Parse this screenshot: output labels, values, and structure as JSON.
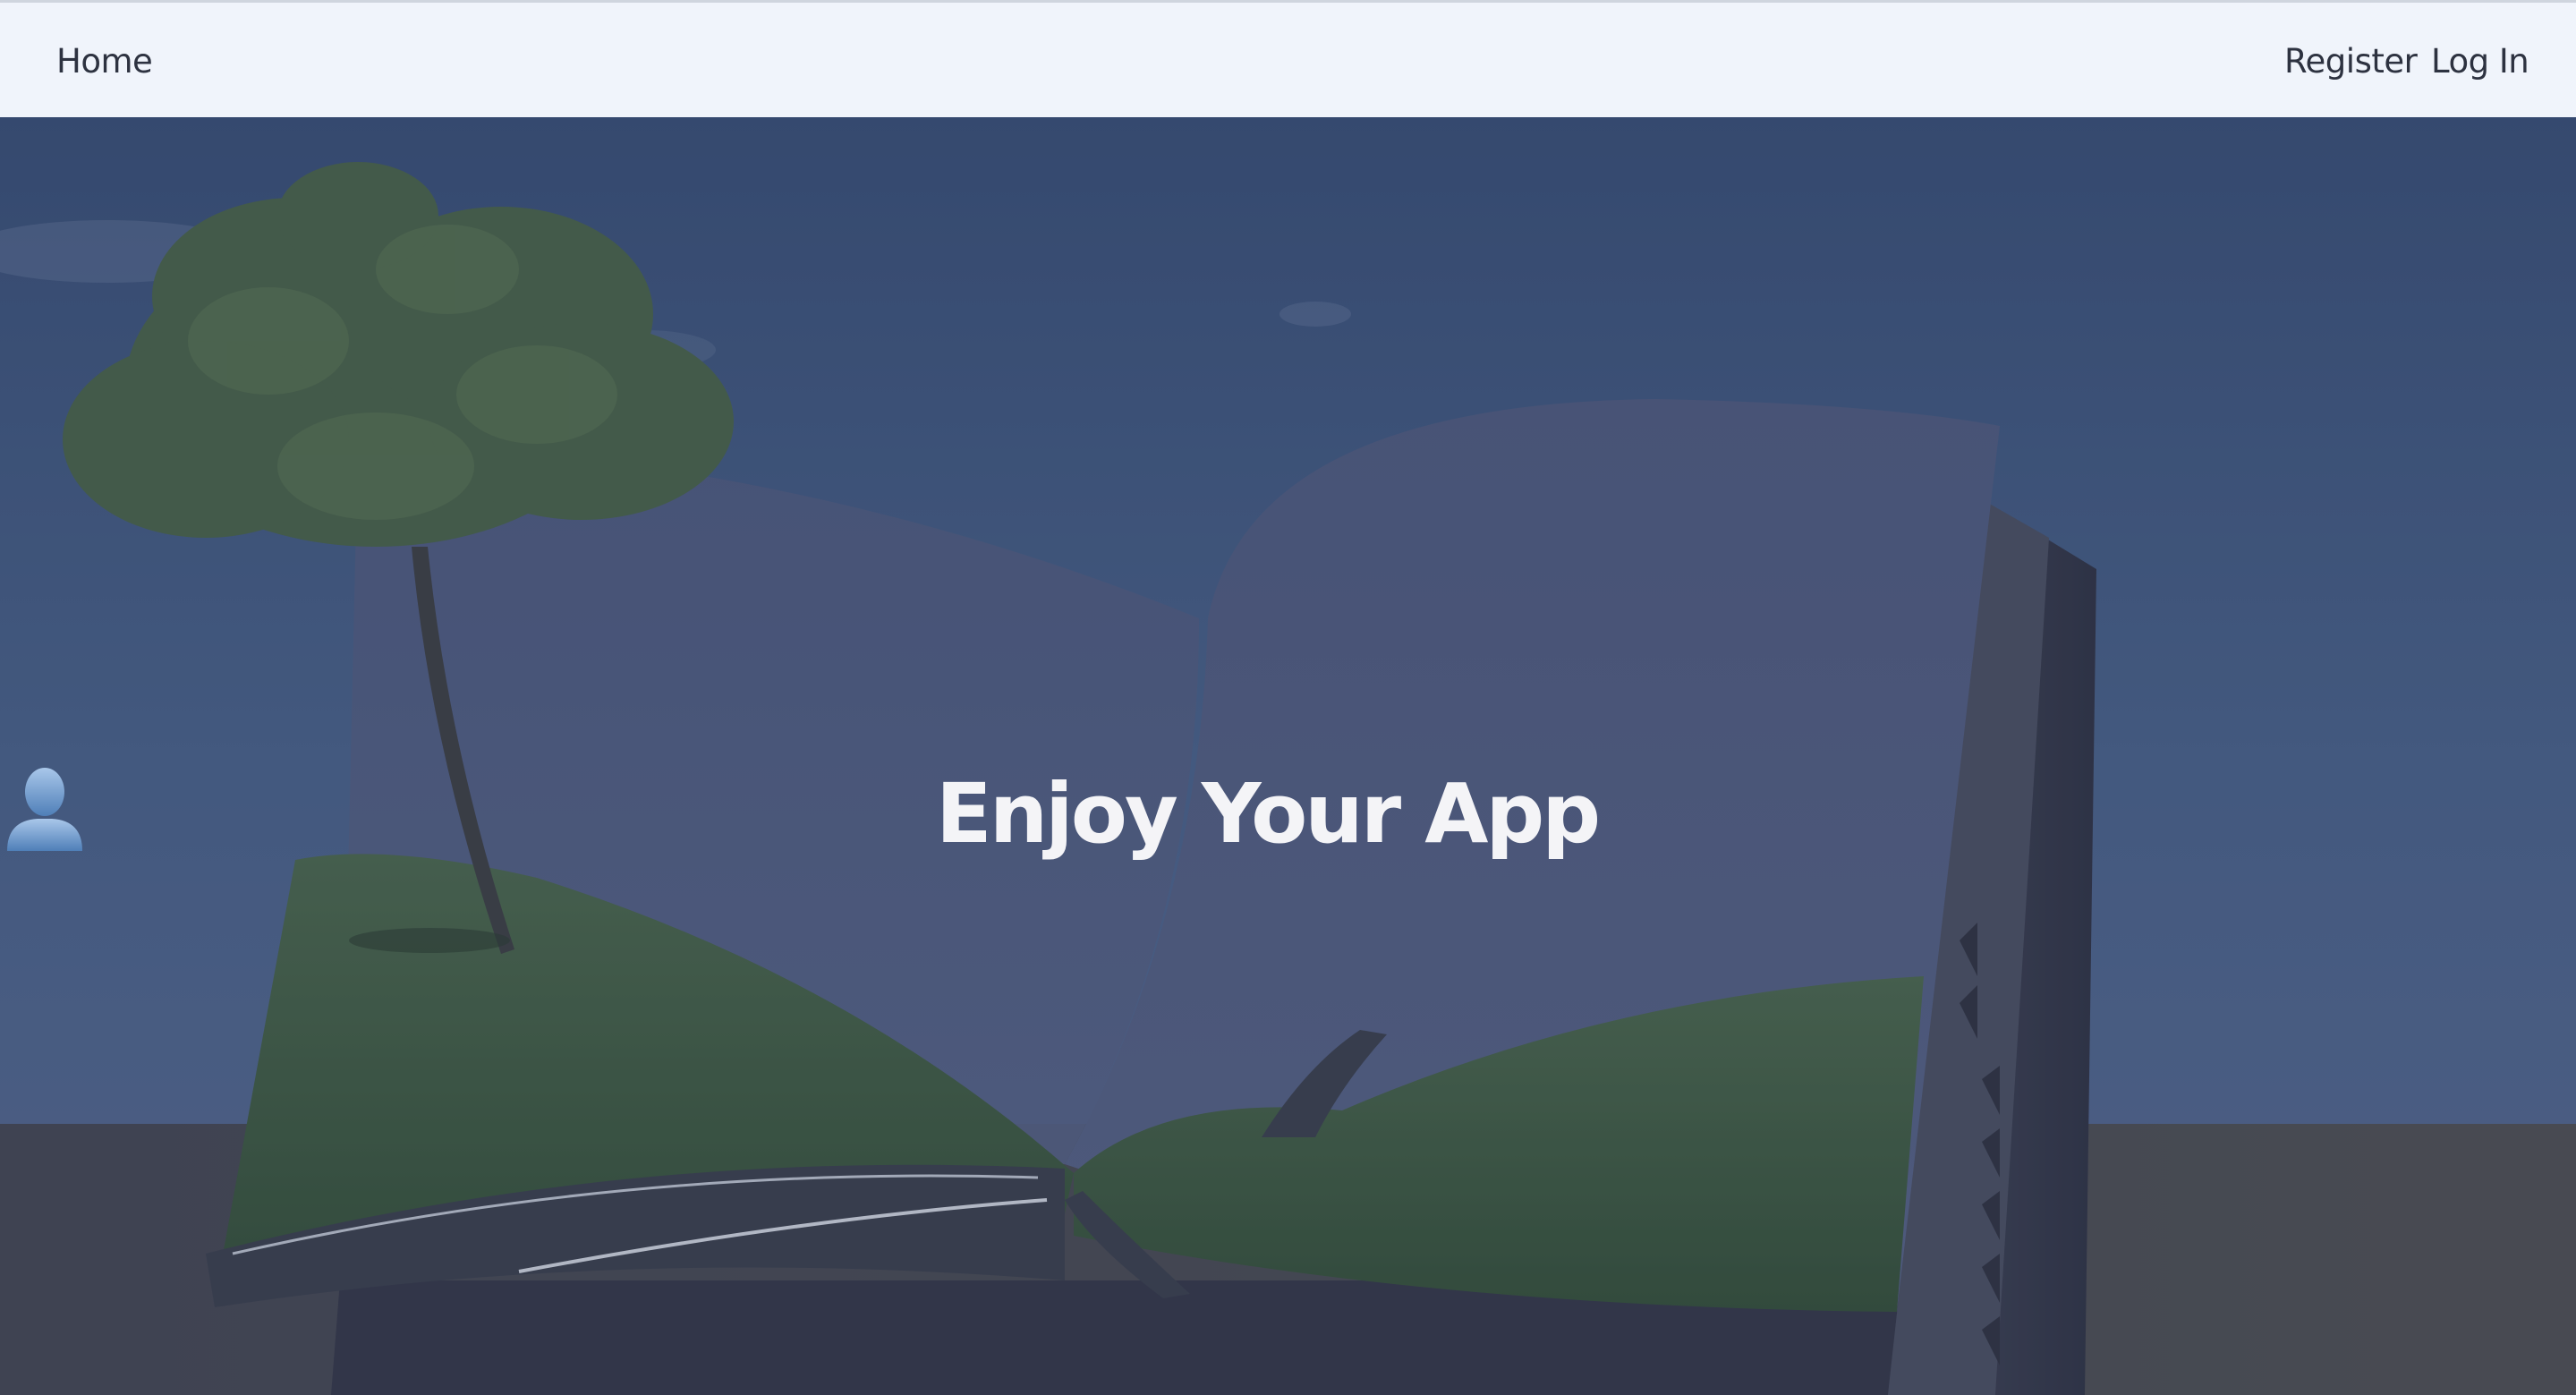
{
  "navbar": {
    "home_label": "Home",
    "register_label": "Register",
    "login_label": "Log In"
  },
  "hero": {
    "title": "Enjoy Your App",
    "title_icon": "person-silhouette-icon",
    "background_description_icon": "open-book-landscape-image"
  },
  "colors": {
    "navbar_bg": "#f0f4fb",
    "nav_text": "#2d3240",
    "hero_title": "#f4f4f7",
    "overlay": "#3b4d6e"
  }
}
